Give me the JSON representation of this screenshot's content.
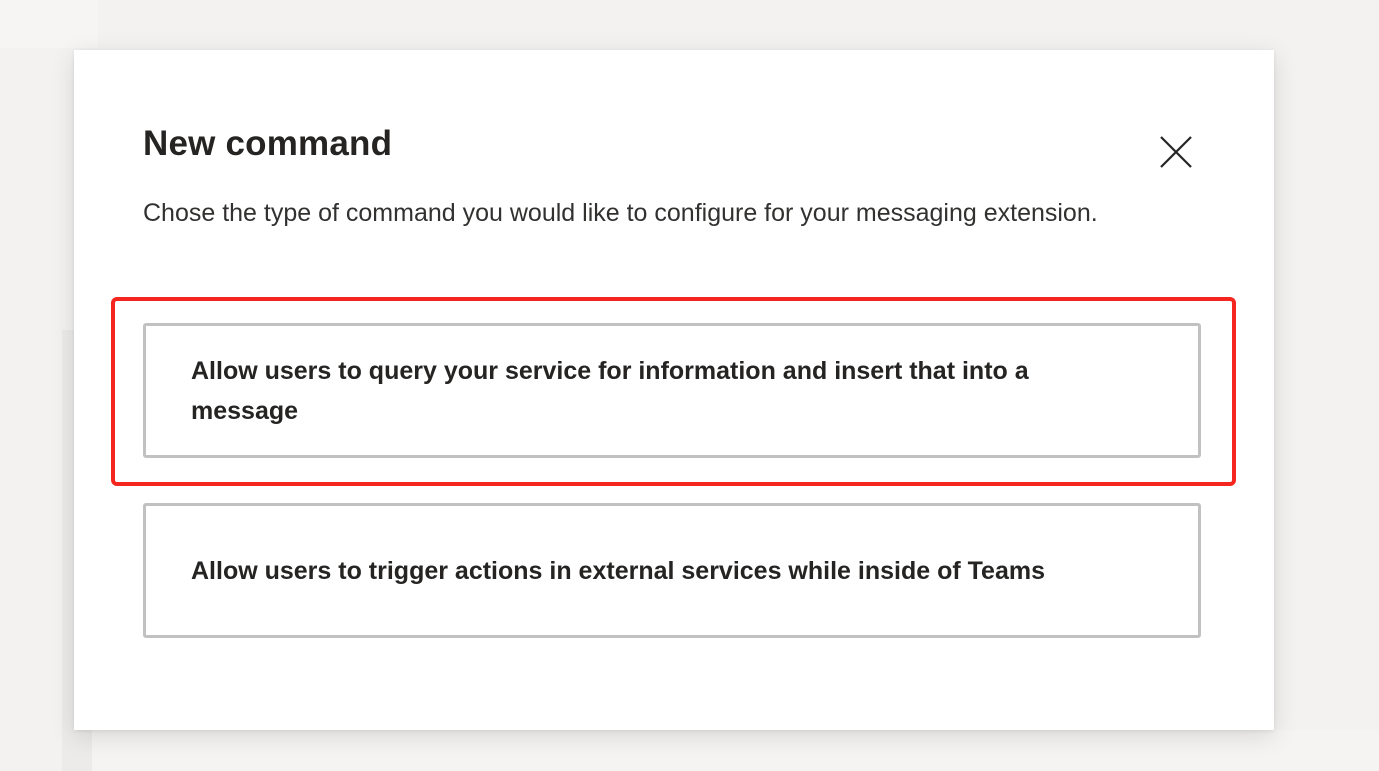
{
  "dialog": {
    "title": "New command",
    "description": "Chose the type of command you would like to configure for your messaging extension.",
    "close_icon": "close-icon",
    "options": [
      {
        "label": "Allow users to query your service for information and insert that into a message"
      },
      {
        "label": "Allow users to trigger actions in external services while inside of Teams"
      }
    ]
  },
  "colors": {
    "highlight": "#f5261f",
    "card_border": "#c1c1c1",
    "title_text": "#252423",
    "background": "#f3f2f1"
  }
}
